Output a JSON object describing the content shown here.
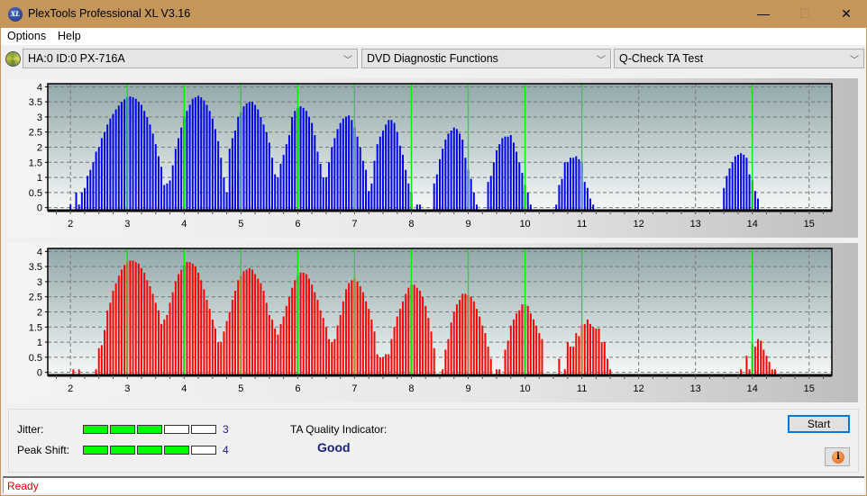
{
  "window": {
    "title": "PlexTools Professional XL V3.16",
    "app_icon_text": "XL",
    "minimize_glyph": "—",
    "maximize_glyph": "☐",
    "close_glyph": "✕"
  },
  "menu": {
    "items": [
      "Options",
      "Help"
    ]
  },
  "toolbar": {
    "drive_select": "HA:0 ID:0  PX-716A",
    "function_select": "DVD Diagnostic Functions",
    "test_select": "Q-Check TA Test",
    "chevron_glyph": "﹀"
  },
  "colors": {
    "top_bars": "#0000ee",
    "bottom_bars": "#ff0000",
    "reference_lines": "#00ee00",
    "meter_on": "#00ff00",
    "status_text": "#e00000",
    "quality_text": "#1a237e"
  },
  "chart_data": [
    {
      "name": "land-chart",
      "type": "bar",
      "color": "#0000ee",
      "xlim": [
        1.6,
        15.4
      ],
      "ylim": [
        -0.1,
        4.1
      ],
      "x_ticks": [
        "2",
        "3",
        "4",
        "5",
        "6",
        "7",
        "8",
        "9",
        "10",
        "11",
        "12",
        "13",
        "14",
        "15"
      ],
      "y_ticks": [
        "0",
        "0.5",
        "1",
        "1.5",
        "2",
        "2.5",
        "3",
        "3.5",
        "4"
      ],
      "reference_lines_x": [
        3,
        4,
        5,
        6,
        7,
        8,
        9,
        10,
        11,
        14
      ],
      "grid": true,
      "bar_step": 0.05,
      "clusters": [
        {
          "x_start": 2.0,
          "values": [
            0.1,
            0,
            0.5,
            0.1,
            0.5,
            0.65,
            1.05,
            1.25,
            1.5,
            1.85,
            2.0,
            2.3,
            2.5,
            2.75,
            2.95,
            3.1,
            3.25,
            3.38,
            3.5,
            3.58,
            3.65,
            3.68,
            3.65,
            3.6,
            3.5,
            3.4,
            3.2,
            3.0,
            2.75,
            2.45,
            2.1,
            1.7,
            1.35,
            0.75,
            0.8,
            0.9
          ]
        },
        {
          "x_start": 3.8,
          "values": [
            1.4,
            1.95,
            2.3,
            2.65,
            3.0,
            3.2,
            3.4,
            3.6,
            3.65,
            3.7,
            3.65,
            3.55,
            3.4,
            3.2,
            2.95,
            2.6,
            2.2,
            1.65,
            1.0,
            0.5,
            0.5,
            0.75,
            0.9,
            1.2
          ]
        },
        {
          "x_start": 4.8,
          "values": [
            1.95,
            2.3,
            2.55,
            3.0,
            3.15,
            3.35,
            3.45,
            3.5,
            3.5,
            3.4,
            3.25,
            3.0,
            2.75,
            2.5,
            2.15,
            1.65,
            1.1,
            1.0,
            1.45,
            1.75,
            2.1,
            2.4,
            2.75
          ]
        },
        {
          "x_start": 5.9,
          "values": [
            3.0,
            3.2,
            3.3,
            3.35,
            3.3,
            3.2,
            3.0,
            2.8,
            2.4,
            1.85,
            1.45,
            1.0,
            1.0,
            1.5,
            2.0,
            2.3,
            2.6,
            2.8,
            2.95,
            3.0,
            3.05,
            2.9,
            2.65,
            2.35,
            2.0,
            1.55,
            1.25,
            0.5
          ]
        },
        {
          "x_start": 7.2,
          "values": [
            0.25,
            0.55,
            0.8,
            1.55,
            2.1,
            2.35,
            2.55,
            2.75,
            2.9,
            2.9,
            2.8,
            2.5,
            2.05,
            1.75,
            1.25,
            0.8,
            0.5,
            0,
            0.1,
            0.1
          ]
        },
        {
          "x_start": 8.4,
          "values": [
            0.8,
            1.1,
            1.6,
            1.95,
            2.25,
            2.45,
            2.55,
            2.65,
            2.6,
            2.45,
            2.25,
            1.65,
            1.25,
            0.95,
            0.5,
            0.1
          ]
        },
        {
          "x_start": 9.35,
          "values": [
            0.85,
            1.05,
            1.5,
            1.9,
            2.1,
            2.3,
            2.35,
            2.35,
            2.4,
            2.15,
            1.85,
            1.5,
            1.15,
            0.75,
            0.5,
            0.1
          ]
        },
        {
          "x_start": 10.55,
          "values": [
            0.1,
            0.75,
            0.95,
            1.5,
            1.5,
            1.65,
            1.65,
            1.7,
            1.6,
            1.5,
            0.85,
            0.65,
            0.3,
            0.1
          ]
        },
        {
          "x_start": 13.5,
          "values": [
            0.65,
            1.05,
            1.3,
            1.5,
            1.7,
            1.75,
            1.8,
            1.75,
            1.65,
            1.1,
            0.9,
            0.55,
            0.3
          ]
        }
      ]
    },
    {
      "name": "pit-chart",
      "type": "bar",
      "color": "#ff0000",
      "xlim": [
        1.6,
        15.4
      ],
      "ylim": [
        -0.1,
        4.1
      ],
      "x_ticks": [
        "2",
        "3",
        "4",
        "5",
        "6",
        "7",
        "8",
        "9",
        "10",
        "11",
        "12",
        "13",
        "14",
        "15"
      ],
      "y_ticks": [
        "0",
        "0.5",
        "1",
        "1.5",
        "2",
        "2.5",
        "3",
        "3.5",
        "4"
      ],
      "reference_lines_x": [
        3,
        4,
        5,
        6,
        7,
        8,
        9,
        10,
        11,
        14
      ],
      "grid": true,
      "bar_step": 0.05,
      "clusters": [
        {
          "x_start": 2.05,
          "values": [
            0.1,
            0,
            0.1
          ]
        },
        {
          "x_start": 2.45,
          "values": [
            0.1,
            0.8,
            0.9,
            1.4,
            2.05,
            2.3,
            2.7,
            2.95,
            3.2,
            3.4,
            3.55,
            3.65,
            3.7,
            3.7,
            3.65,
            3.6,
            3.45,
            3.3,
            3.05,
            2.85,
            2.6,
            2.3,
            2.05,
            1.6,
            1.75,
            1.9,
            2.3,
            2.65,
            3.0,
            3.25,
            3.4,
            3.55,
            3.65,
            3.65,
            3.6,
            3.5,
            3.3,
            3.05,
            2.75,
            2.4,
            2.1,
            1.75,
            1.45,
            1.0,
            1.0,
            1.35,
            1.7,
            2.0,
            2.4,
            2.7,
            3.05,
            3.2,
            3.35,
            3.4,
            3.45,
            3.4,
            3.25,
            3.1,
            2.95,
            2.7,
            2.3,
            1.9,
            1.75,
            1.45,
            1.25,
            1.6,
            1.85,
            2.2,
            2.5,
            2.8,
            3.05,
            3.2,
            3.3,
            3.3,
            3.25,
            3.1,
            2.9,
            2.65,
            2.4,
            2.05,
            1.8,
            1.5,
            1.1,
            1.0,
            1.1,
            1.55,
            1.9,
            2.35,
            2.75,
            2.95,
            3.05,
            3.1,
            3.0,
            2.85,
            2.65,
            2.35,
            2.1,
            1.75,
            1.35,
            0.6,
            0.5,
            0.5,
            0.6,
            0.6,
            1.1,
            1.5,
            1.85,
            2.1,
            2.35,
            2.6,
            2.8,
            2.9,
            2.9,
            2.8,
            2.7,
            2.5,
            2.2,
            1.8,
            1.35,
            0.8
          ]
        },
        {
          "x_start": 8.55,
          "values": [
            0.1,
            0.75,
            1.1,
            1.65,
            2.0,
            2.25,
            2.4,
            2.6,
            2.6,
            2.55,
            2.5,
            2.35,
            2.1,
            1.85,
            1.55,
            1.3,
            0.85,
            0.45,
            0,
            0.1,
            0.1,
            0,
            0.75,
            1.05,
            1.55,
            1.75,
            1.95,
            2.05,
            2.25,
            2.25,
            2.2,
            1.95,
            1.75,
            1.55,
            1.3,
            1.1
          ]
        },
        {
          "x_start": 10.6,
          "values": [
            0.45,
            0,
            0.1,
            1.0,
            0.85,
            0.85,
            1.3,
            1.2,
            1.55,
            1.6,
            1.75,
            1.6,
            1.5,
            1.45,
            1.45,
            1.0,
            1.0,
            0.45,
            0.1
          ]
        },
        {
          "x_start": 13.8,
          "values": [
            0.1,
            0,
            0.55,
            0.1,
            0.95,
            0.85,
            1.1,
            1.05,
            0.75,
            0.55,
            0.35,
            0.1,
            0.1
          ]
        }
      ]
    }
  ],
  "bottom": {
    "jitter_label": "Jitter:",
    "jitter_value": 3,
    "peak_shift_label": "Peak Shift:",
    "peak_shift_value": 4,
    "meter_max": 5,
    "ta_quality_label": "TA Quality Indicator:",
    "ta_quality_value": "Good",
    "start_label": "Start",
    "info_glyph": "i"
  },
  "status": {
    "text": "Ready"
  }
}
